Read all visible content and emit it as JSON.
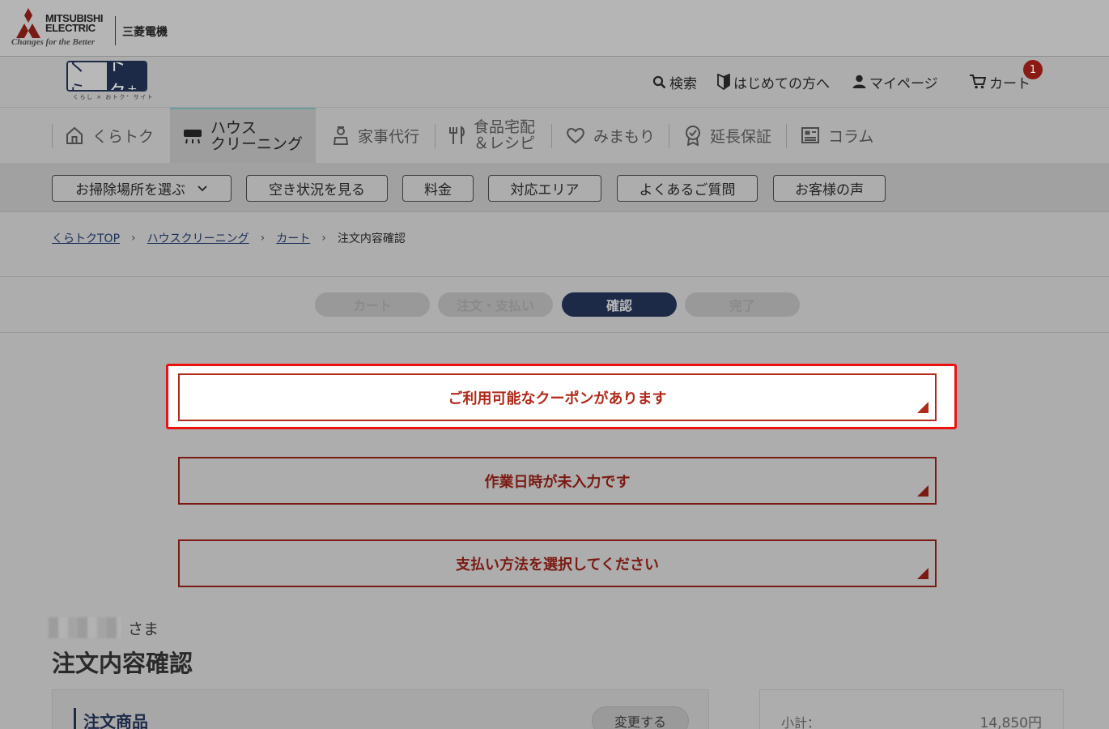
{
  "brand": {
    "corp_en_line1": "MITSUBISHI",
    "corp_en_line2": "ELECTRIC",
    "slogan": "Changes for the Better",
    "corp_jp": "三菱電機",
    "site_logo_left": "くら",
    "site_logo_right": "トク⁺",
    "site_logo_sub": "くらし × おトク⁺ サイト",
    "accent_color": "#1c2a48",
    "alert_color": "#7b1a12"
  },
  "header_links": {
    "search": "検索",
    "beginners": "はじめての方へ",
    "mypage": "マイページ",
    "cart": "カート",
    "cart_count": "1"
  },
  "main_nav": {
    "home": "くらトク",
    "house_line1": "ハウス",
    "house_line2": "クリーニング",
    "housework": "家事代行",
    "food_line1": "食品宅配",
    "food_line2": "＆レシピ",
    "watch": "みまもり",
    "warranty": "延長保証",
    "column": "コラム"
  },
  "sub_nav": {
    "place": "お掃除場所を選ぶ",
    "availability": "空き状況を見る",
    "price": "料金",
    "area": "対応エリア",
    "faq": "よくあるご質問",
    "voice": "お客様の声"
  },
  "breadcrumb": {
    "top": "くらトクTOP",
    "house": "ハウスクリーニング",
    "cart": "カート",
    "current": "注文内容確認"
  },
  "steps": {
    "cart": "カート",
    "order": "注文・支払い",
    "confirm": "確認",
    "done": "完了"
  },
  "alerts": {
    "coupon": "ご利用可能なクーポンがあります",
    "datetime": "作業日時が未入力です",
    "payment": "支払い方法を選択してください"
  },
  "user": {
    "honorific": "さま"
  },
  "page_title": "注文内容確認",
  "order_card": {
    "title": "注文商品",
    "change": "変更する"
  },
  "summary_card": {
    "subtotal_label": "小計：",
    "subtotal_value": "14,850円"
  }
}
